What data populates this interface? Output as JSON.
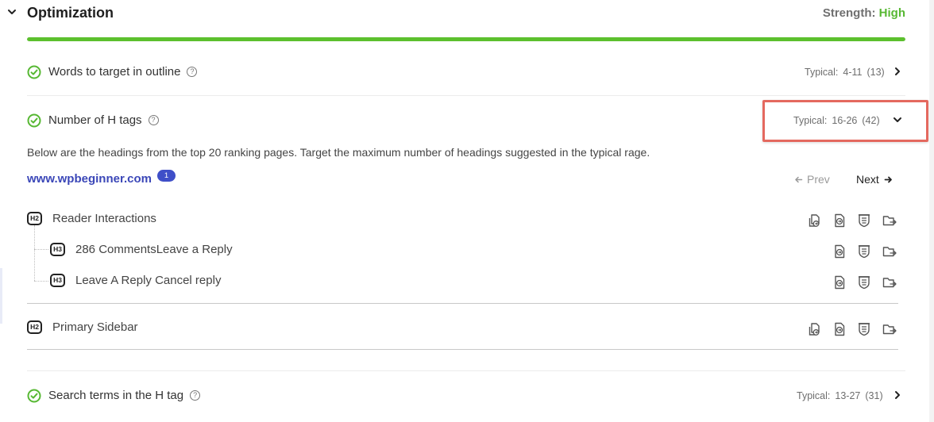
{
  "header": {
    "title": "Optimization",
    "strength_label": "Strength:",
    "strength_value": "High"
  },
  "progress": {
    "fraction": 1.0,
    "color": "#5cc02e"
  },
  "rows": [
    {
      "label": "Words to target in outline",
      "typical_label": "Typical:",
      "typical_range": "4-11",
      "typical_count": "(13)"
    },
    {
      "label": "Number of H tags",
      "typical_label": "Typical:",
      "typical_range": "16-26",
      "typical_count": "(42)"
    },
    {
      "label": "Search terms in the H tag",
      "typical_label": "Typical:",
      "typical_range": "13-27",
      "typical_count": "(31)"
    }
  ],
  "detail": {
    "description": "Below are the headings from the top 20 ranking pages. Target the maximum number of headings suggested in the typical rage.",
    "site": "www.wpbeginner.com",
    "badge": "1",
    "prev_label": "Prev",
    "next_label": "Next",
    "headings": [
      {
        "tag": "H2",
        "text": "Reader Interactions"
      },
      {
        "tag": "H3",
        "text": "286 CommentsLeave a Reply"
      },
      {
        "tag": "H3",
        "text": "Leave A Reply Cancel reply"
      },
      {
        "tag": "H2",
        "text": "Primary Sidebar"
      }
    ]
  },
  "colors": {
    "accent_green": "#57b833",
    "link_blue": "#3b47b8",
    "highlight_red": "#e4695f"
  },
  "icons": [
    "chevron-down-icon",
    "check-circle-icon",
    "help-circle-icon",
    "chevron-right-icon",
    "arrow-left-icon",
    "arrow-right-icon",
    "copy-doc-icon",
    "insert-doc-icon",
    "outline-icon",
    "folder-icon"
  ]
}
